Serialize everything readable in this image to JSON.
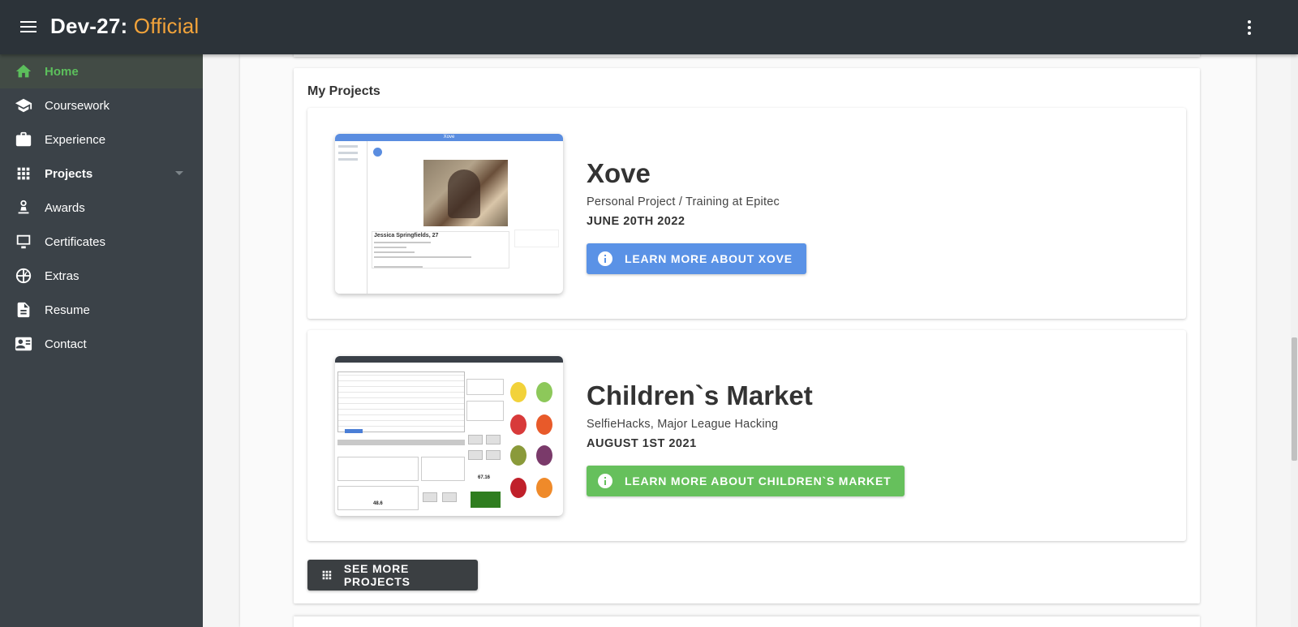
{
  "app": {
    "brand_main": "Dev-27:",
    "brand_accent": "Official"
  },
  "colors": {
    "topbar": "#2c3339",
    "sidebar": "#3b4248",
    "active": "#5cbf5c",
    "accent": "#f2a33a",
    "blue_button": "#5a92e6",
    "green_button": "#66c05c"
  },
  "sidebar": {
    "items": [
      {
        "label": "Home",
        "icon": "home-icon"
      },
      {
        "label": "Coursework",
        "icon": "school-icon"
      },
      {
        "label": "Experience",
        "icon": "briefcase-icon"
      },
      {
        "label": "Projects",
        "icon": "apps-grid-icon"
      },
      {
        "label": "Awards",
        "icon": "award-icon"
      },
      {
        "label": "Certificates",
        "icon": "certificate-icon"
      },
      {
        "label": "Extras",
        "icon": "basketball-icon"
      },
      {
        "label": "Resume",
        "icon": "document-icon"
      },
      {
        "label": "Contact",
        "icon": "contact-card-icon"
      }
    ]
  },
  "projects_section": {
    "title": "My Projects",
    "projects": [
      {
        "name": "Xove",
        "subtitle": "Personal Project / Training at Epitec",
        "date": "JUNE 20TH 2022",
        "button": "LEARN MORE ABOUT XOVE",
        "thumb_title": "Xove",
        "thumb_profile": "Jessica Springfields, 27"
      },
      {
        "name": "Children`s Market",
        "subtitle": "SelfieHacks, Major League Hacking",
        "date": "AUGUST 1ST 2021",
        "button": "LEARN MORE ABOUT CHILDREN`S MARKET",
        "thumb_total": "67.16",
        "thumb_total2": "48.6"
      }
    ],
    "see_more": "SEE MORE PROJECTS"
  }
}
